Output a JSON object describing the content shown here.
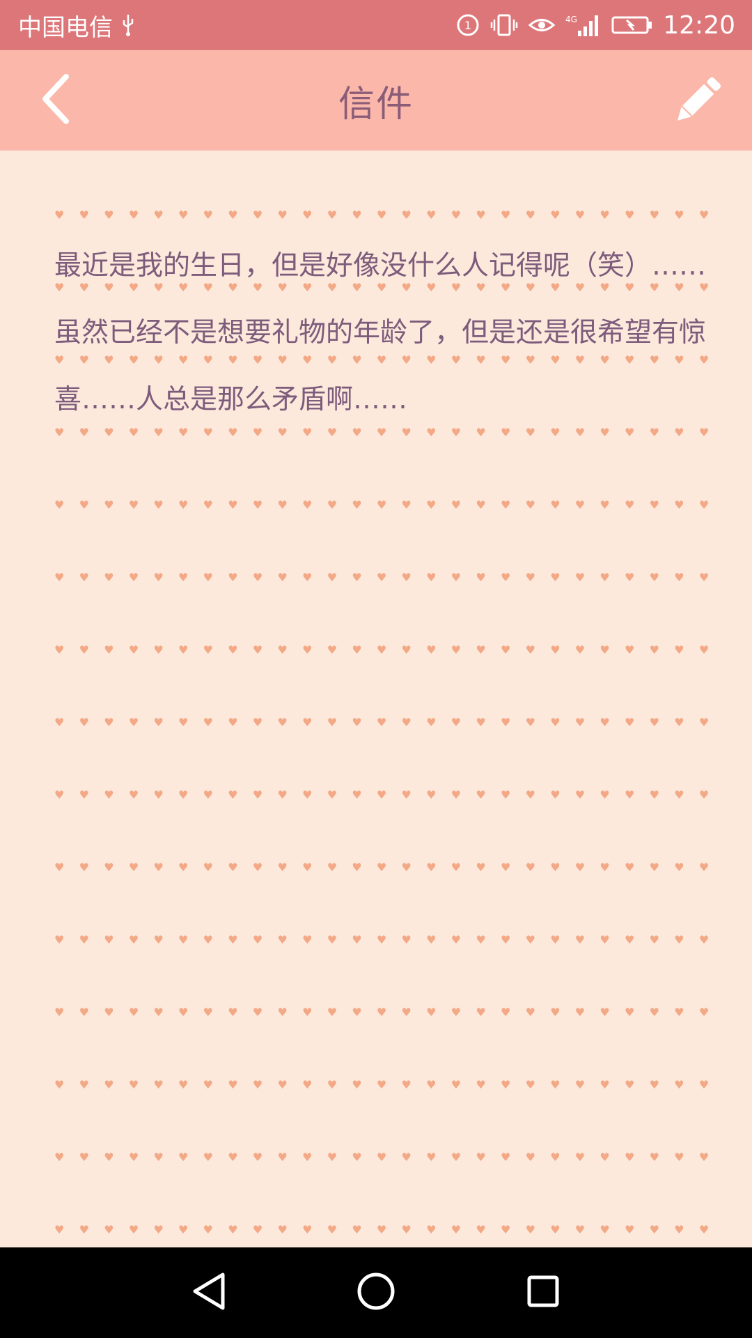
{
  "status_bar": {
    "carrier": "中国电信",
    "time": "12:20",
    "network": "4G",
    "icons": [
      "usb-icon",
      "data-saver-icon",
      "vibrate-icon",
      "eye-comfort-icon",
      "signal-icon",
      "battery-charging-icon"
    ]
  },
  "header": {
    "title": "信件",
    "back_icon": "chevron-left-icon",
    "edit_icon": "pencil-icon"
  },
  "letter": {
    "body": "最近是我的生日，但是好像没什么人记得呢（笑）……虽然已经不是想要礼物的年龄了，但是还是很希望有惊喜……人总是那么矛盾啊……"
  },
  "nav_bar": {
    "buttons": [
      "back-triangle-icon",
      "home-circle-icon",
      "recents-square-icon"
    ]
  },
  "colors": {
    "status_bar": "#dd7679",
    "header": "#fbb7a9",
    "paper": "#fce9dc",
    "text": "#7d5b7b",
    "hearts": "#f3a886"
  }
}
